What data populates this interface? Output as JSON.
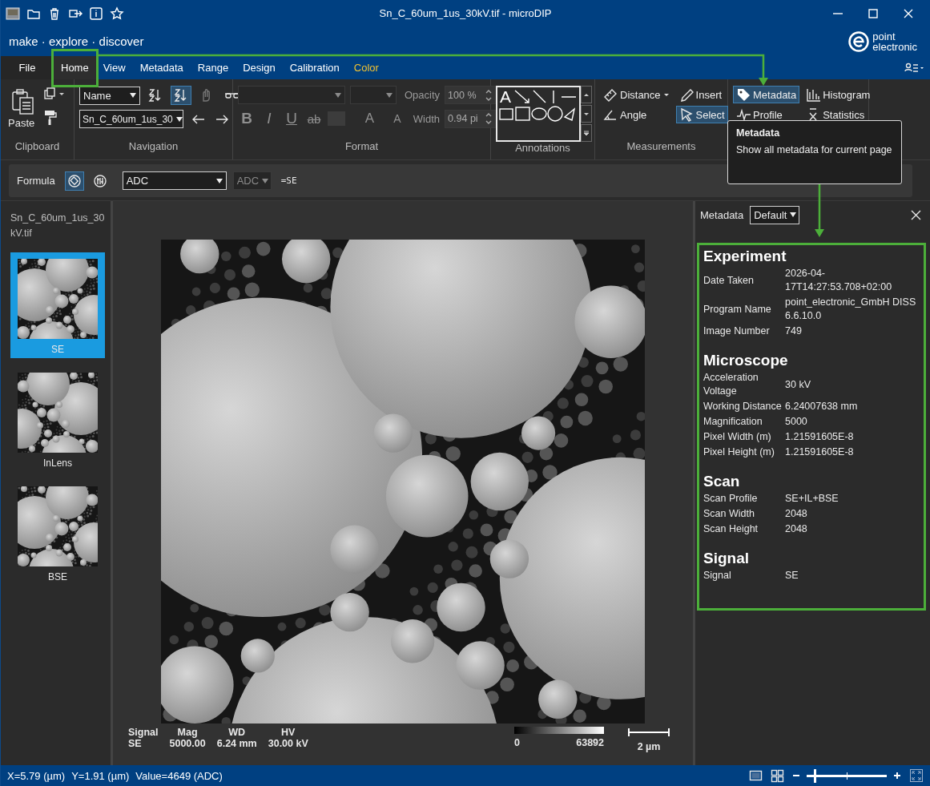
{
  "title_bar": {
    "title": "Sn_C_60um_1us_30kV.tif - microDIP"
  },
  "brand": {
    "tagline": "make · explore · discover",
    "logo_lines": [
      "point",
      "electronic"
    ]
  },
  "menu_tabs": [
    {
      "label": "File",
      "kind": "file",
      "selected": false
    },
    {
      "label": "Home",
      "kind": "tab",
      "selected": true
    },
    {
      "label": "View",
      "kind": "tab",
      "selected": false
    },
    {
      "label": "Metadata",
      "kind": "tab",
      "selected": false
    },
    {
      "label": "Range",
      "kind": "tab",
      "selected": false
    },
    {
      "label": "Design",
      "kind": "tab",
      "selected": false
    },
    {
      "label": "Calibration",
      "kind": "tab",
      "selected": false
    },
    {
      "label": "Color",
      "kind": "accent",
      "selected": false
    }
  ],
  "ribbon": {
    "clipboard": {
      "label": "Clipboard",
      "paste": "Paste"
    },
    "navigation": {
      "label": "Navigation",
      "sort_field": "Name",
      "file": "Sn_C_60um_1us_30",
      "buttons": [
        {
          "kind": "sort-desc",
          "selected": false,
          "disabled": false
        },
        {
          "kind": "sort-asc",
          "selected": true,
          "disabled": false
        },
        {
          "kind": "hand",
          "selected": false,
          "disabled": true
        },
        {
          "kind": "glasses",
          "selected": false,
          "disabled": false
        }
      ]
    },
    "format": {
      "label": "Format",
      "opacity_label": "Opacity",
      "opacity": "100 %",
      "width_label": "Width",
      "width": "0.94 pi",
      "style_buttons": [
        {
          "label": "B",
          "kind": "bold"
        },
        {
          "label": "I",
          "kind": "italic"
        },
        {
          "label": "U",
          "kind": "underline"
        },
        {
          "label": "ab",
          "kind": "strike"
        }
      ],
      "size_buttons": [
        {
          "label": "A",
          "kind": "grow"
        },
        {
          "label": "A",
          "kind": "shrink"
        }
      ]
    },
    "annotations": {
      "label": "Annotations",
      "gallery_letter": "A"
    },
    "measurements": {
      "label": "Measurements",
      "tools": [
        {
          "label": "Distance",
          "kind": "distance",
          "dropdown": true,
          "selected": false
        },
        {
          "label": "Insert",
          "kind": "insert",
          "dropdown": false,
          "selected": false
        },
        {
          "label": "Angle",
          "kind": "angle",
          "dropdown": false,
          "selected": false
        },
        {
          "label": "Select",
          "kind": "select",
          "dropdown": false,
          "selected": true
        }
      ]
    },
    "analysis": {
      "tools": [
        {
          "label": "Metadata",
          "kind": "metadata",
          "selected": true
        },
        {
          "label": "Histogram",
          "kind": "histogram",
          "selected": false
        },
        {
          "label": "Profile",
          "kind": "profile",
          "selected": false
        },
        {
          "label": "Statistics",
          "kind": "statistics",
          "selected": false
        }
      ]
    }
  },
  "tooltip": {
    "title": "Metadata",
    "text": "Show all metadata for current page"
  },
  "formula": {
    "label": "Formula",
    "modes": [
      {
        "kind": "image",
        "selected": true
      },
      {
        "kind": "table",
        "selected": false
      }
    ],
    "source": "ADC",
    "channel": "ADC",
    "channel_disabled": true,
    "expression": "=SE"
  },
  "pages": {
    "file": "Sn_C_60um_1us_30kV.tif",
    "thumbnails": [
      {
        "label": "SE",
        "selected": true
      },
      {
        "label": "InLens",
        "selected": false
      },
      {
        "label": "BSE",
        "selected": false
      }
    ]
  },
  "image_info": {
    "fields": [
      {
        "label": "Signal",
        "value": "SE"
      },
      {
        "label": "Mag",
        "value": "5000.00"
      },
      {
        "label": "WD",
        "value": "6.24 mm"
      },
      {
        "label": "HV",
        "value": "30.00 kV"
      }
    ],
    "colorbar_min": "0",
    "colorbar_max": "63892",
    "scale": "2 µm"
  },
  "metadata_panel": {
    "title": "Metadata",
    "preset": "Default",
    "sections": [
      {
        "title": "Experiment",
        "rows": [
          {
            "key": "Date Taken",
            "value": "2026-04-17T14:27:53.708+02:00"
          },
          {
            "key": "Program Name",
            "value": "point_electronic_GmbH DISS 6.6.10.0"
          },
          {
            "key": "Image Number",
            "value": "749"
          }
        ]
      },
      {
        "title": "Microscope",
        "rows": [
          {
            "key": "Acceleration Voltage",
            "value": "30 kV"
          },
          {
            "key": "Working Distance",
            "value": "6.24007638 mm"
          },
          {
            "key": "Magnification",
            "value": "5000"
          },
          {
            "key": "Pixel Width (m)",
            "value": "1.21591605E-8"
          },
          {
            "key": "Pixel Height (m)",
            "value": "1.21591605E-8"
          }
        ]
      },
      {
        "title": "Scan",
        "rows": [
          {
            "key": "Scan Profile",
            "value": "SE+IL+BSE"
          },
          {
            "key": "Scan Width",
            "value": "2048"
          },
          {
            "key": "Scan Height",
            "value": "2048"
          }
        ]
      },
      {
        "title": "Signal",
        "rows": [
          {
            "key": "Signal",
            "value": "SE"
          }
        ]
      }
    ]
  },
  "status_bar": {
    "items": [
      "X=5.79 (µm)",
      "Y=1.91 (µm)",
      "Value=4649 (ADC)"
    ],
    "zoom": {
      "level": 0.1
    }
  }
}
